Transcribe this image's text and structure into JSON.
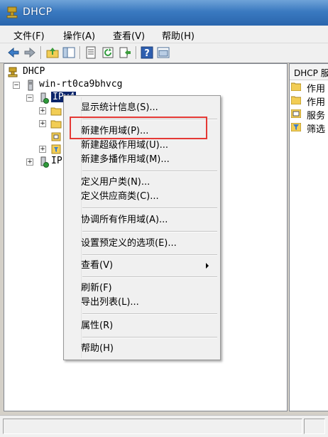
{
  "window": {
    "title": "DHCP"
  },
  "menubar": {
    "items": [
      "文件(F)",
      "操作(A)",
      "查看(V)",
      "帮助(H)"
    ]
  },
  "toolbar": {
    "buttons": [
      "back-icon",
      "forward-icon",
      "up-icon",
      "show-hide-tree-icon",
      "properties-icon",
      "refresh-icon",
      "export-icon",
      "help-icon",
      "console-icon"
    ]
  },
  "tree": {
    "root": "DHCP",
    "server": "win-rt0ca9bhvcg",
    "ipv4": "IPv4",
    "ipv6": "IP"
  },
  "right_pane": {
    "header": "DHCP 服",
    "rows": [
      "作用",
      "作用",
      "服务",
      "筛选"
    ]
  },
  "context_menu": {
    "items": [
      "显示统计信息(S)...",
      "新建作用域(P)...",
      "新建超级作用域(U)...",
      "新建多播作用域(M)...",
      "定义用户类(N)...",
      "定义供应商类(C)...",
      "协调所有作用域(A)...",
      "设置预定义的选项(E)...",
      "查看(V)",
      "刷新(F)",
      "导出列表(L)...",
      "属性(R)",
      "帮助(H)"
    ]
  },
  "colors": {
    "highlight_box": "#e53935",
    "selection": "#0a246a",
    "titlebar": "#3a79c0"
  }
}
